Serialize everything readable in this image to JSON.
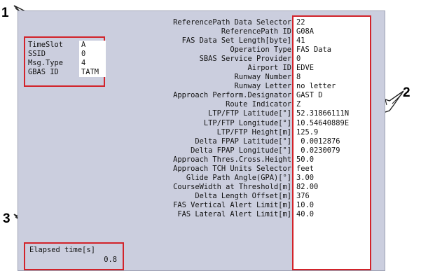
{
  "callouts": {
    "one": "1",
    "two": "2",
    "three": "3"
  },
  "info": {
    "labels": [
      "TimeSlot",
      "SSID",
      "Msg.Type",
      "GBAS ID"
    ],
    "values": [
      "A",
      "0",
      "4",
      "TATM"
    ]
  },
  "fields": [
    {
      "label": "ReferencePath Data Selector",
      "value": "22"
    },
    {
      "label": "ReferencePath ID",
      "value": "G08A"
    },
    {
      "label": "FAS Data Set Length[byte]",
      "value": "41"
    },
    {
      "label": "Operation Type",
      "value": "FAS Data"
    },
    {
      "label": "SBAS Service Provider",
      "value": "0"
    },
    {
      "label": "Airport ID",
      "value": "EDVE"
    },
    {
      "label": "Runway Number",
      "value": "8"
    },
    {
      "label": "Runway Letter",
      "value": "no letter"
    },
    {
      "label": "Approach Perform.Designator",
      "value": "GAST D"
    },
    {
      "label": "Route Indicator",
      "value": "Z"
    },
    {
      "label": "LTP/FTP Latitude[°]",
      "value": "52.31866111N"
    },
    {
      "label": "LTP/FTP Longitude[°]",
      "value": "10.54640889E"
    },
    {
      "label": "LTP/FTP Height[m]",
      "value": "125.9"
    },
    {
      "label": "Delta FPAP Latitude[°]",
      "value": " 0.0012876"
    },
    {
      "label": "Delta FPAP Longitude[°]",
      "value": " 0.0230079"
    },
    {
      "label": "Approach Thres.Cross.Height",
      "value": "50.0"
    },
    {
      "label": "Approach TCH Units Selector",
      "value": "feet"
    },
    {
      "label": "Glide Path Angle(GPA)[°]",
      "value": "3.00"
    },
    {
      "label": "CourseWidth at Threshold[m]",
      "value": "82.00"
    },
    {
      "label": "Delta Length Offset[m]",
      "value": "376"
    },
    {
      "label": "FAS Vertical Alert Limit[m]",
      "value": "10.0"
    },
    {
      "label": "FAS Lateral Alert Limit[m]",
      "value": "40.0"
    }
  ],
  "elapsed": {
    "label": "Elapsed time[s]",
    "value": "0.8"
  },
  "colors": {
    "panel": "#cbcede",
    "highlight": "#d2232a"
  },
  "icons": {
    "pointer": "pointing-hand-icon"
  }
}
